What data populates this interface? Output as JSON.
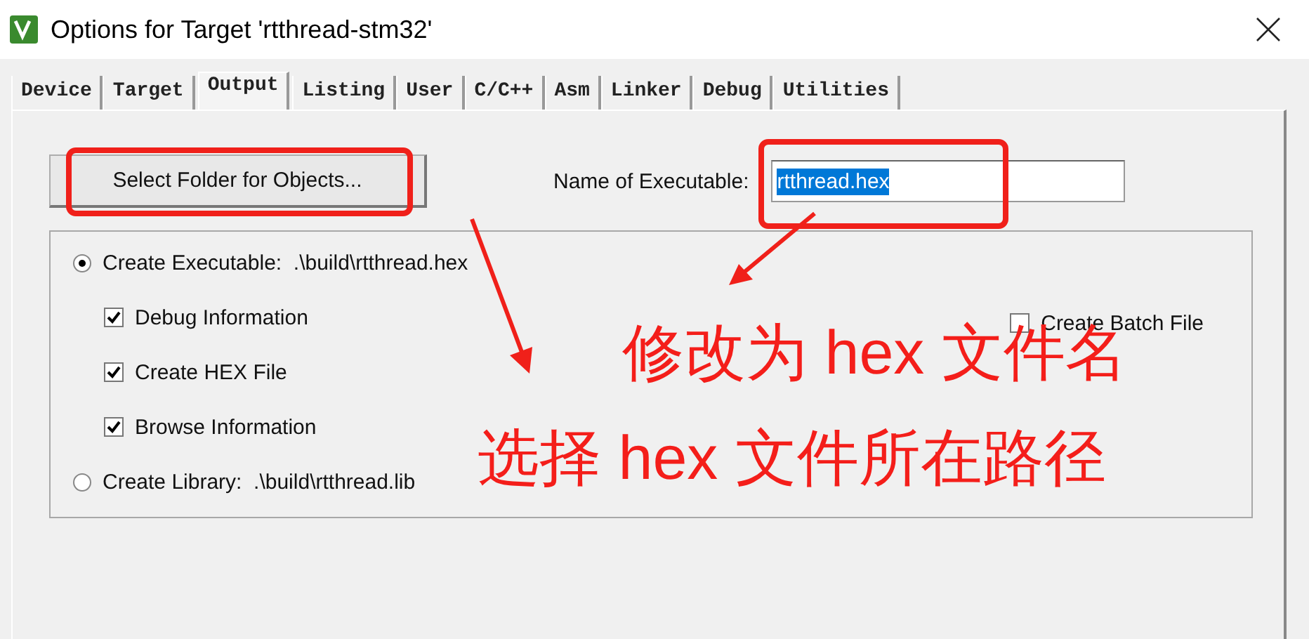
{
  "window": {
    "title": "Options for Target 'rtthread-stm32'"
  },
  "tabs": [
    {
      "label": "Device",
      "selected": false
    },
    {
      "label": "Target",
      "selected": false
    },
    {
      "label": "Output",
      "selected": true
    },
    {
      "label": "Listing",
      "selected": false
    },
    {
      "label": "User",
      "selected": false
    },
    {
      "label": "C/C++",
      "selected": false
    },
    {
      "label": "Asm",
      "selected": false
    },
    {
      "label": "Linker",
      "selected": false
    },
    {
      "label": "Debug",
      "selected": false
    },
    {
      "label": "Utilities",
      "selected": false
    }
  ],
  "select_folder_button": "Select Folder for Objects...",
  "executable_name": {
    "label": "Name of Executable:",
    "value": "rtthread.hex",
    "value_selected": true
  },
  "options": [
    {
      "kind": "radio",
      "label": "Create Executable:  .\\build\\rtthread.hex",
      "selected": true
    },
    {
      "kind": "checkbox",
      "label": "Debug Information",
      "checked": true
    },
    {
      "kind": "checkbox",
      "label": "Create HEX File",
      "checked": true
    },
    {
      "kind": "checkbox",
      "label": "Browse Information",
      "checked": true
    },
    {
      "kind": "radio",
      "label": "Create Library:  .\\build\\rtthread.lib",
      "selected": false
    }
  ],
  "batch_file": {
    "label": "Create Batch File",
    "checked": false
  },
  "annotations": [
    {
      "text": "修改为 hex 文件名"
    },
    {
      "text": "选择 hex 文件所在路径"
    }
  ]
}
